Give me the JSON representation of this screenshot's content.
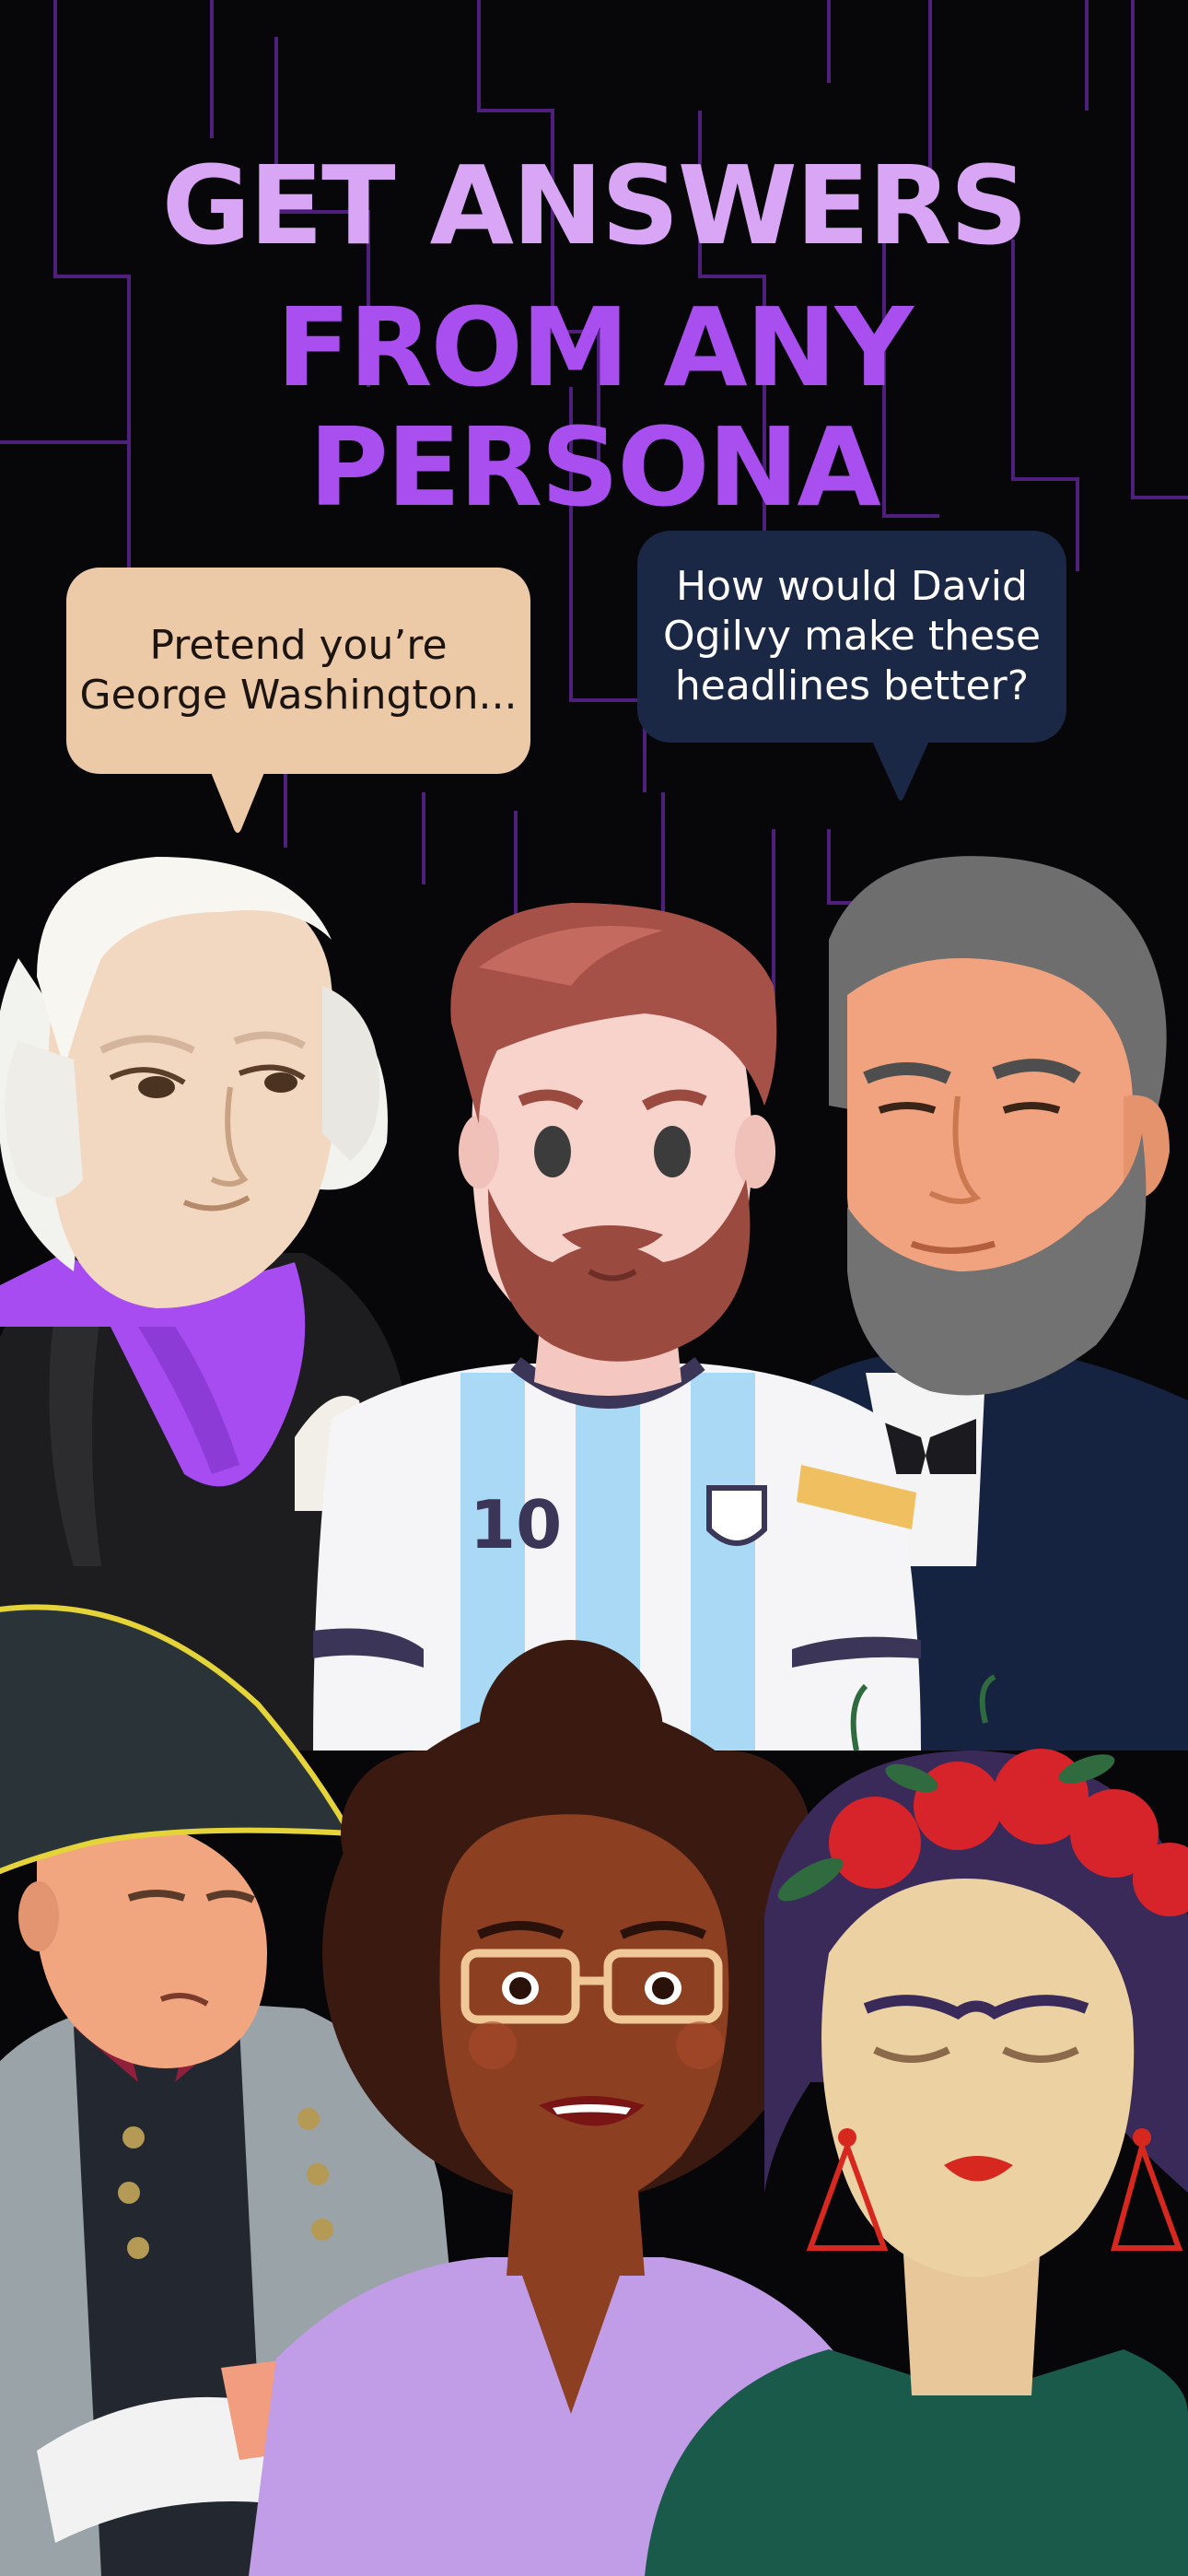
{
  "headline": {
    "line1": "GET ANSWERS",
    "line2": "FROM ANY PERSONA"
  },
  "bubbles": {
    "left": "Pretend you’re\nGeorge Washington...",
    "right": "How would David\nOgilvy make these\nheadlines better?"
  },
  "jersey": {
    "number": "10"
  },
  "colors": {
    "background": "#070608",
    "headline_light": "#d9a6f5",
    "headline_dark": "#a94ff0",
    "circuit": "#6b2fa8",
    "bubble_left": "#ecc9a7",
    "bubble_right": "#1a2845"
  }
}
